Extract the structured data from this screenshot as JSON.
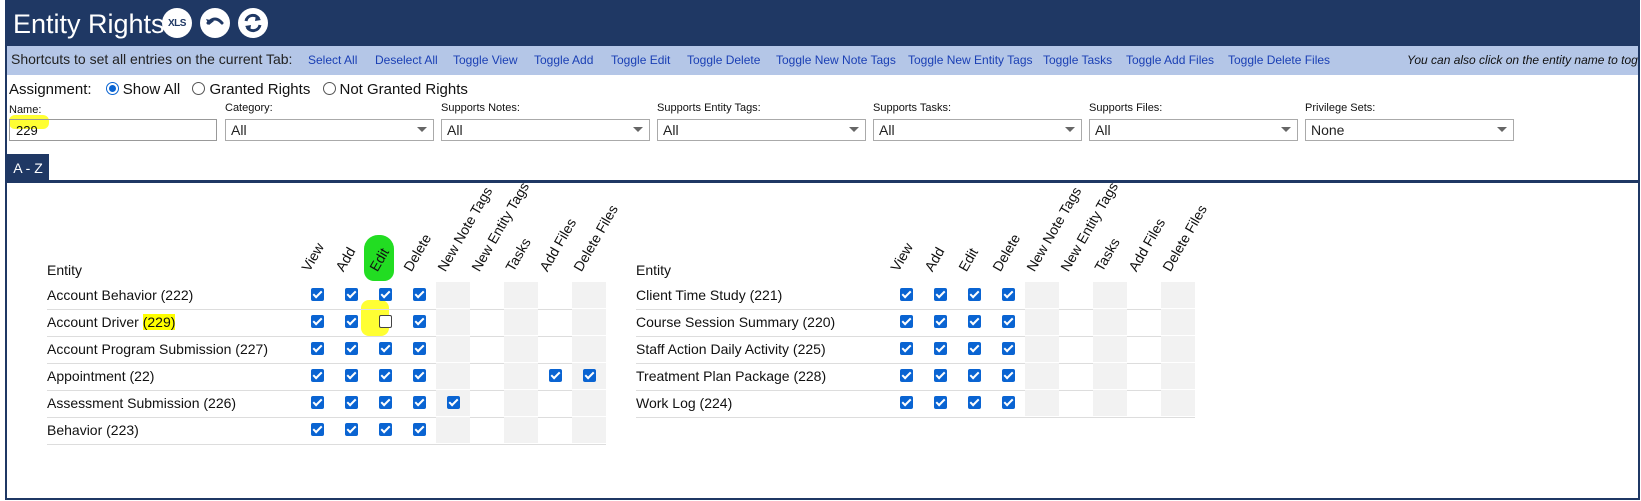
{
  "header": {
    "title": "Entity Rights",
    "icons": [
      "xls-export-icon",
      "undo-icon",
      "refresh-icon"
    ],
    "xls_text": "XLS"
  },
  "shortcuts": {
    "label": "Shortcuts to set all entries on the current Tab:",
    "links": [
      "Select All",
      "Deselect All",
      "Toggle View",
      "Toggle Add",
      "Toggle Edit",
      "Toggle Delete",
      "Toggle New Note Tags",
      "Toggle New Entity Tags",
      "Toggle Tasks",
      "Toggle Add Files",
      "Toggle Delete Files"
    ],
    "hint": "You can also click on the entity name to toggle"
  },
  "assignment": {
    "label": "Assignment:",
    "options": [
      {
        "label": "Show All",
        "selected": true
      },
      {
        "label": "Granted Rights",
        "selected": false
      },
      {
        "label": "Not Granted Rights",
        "selected": false
      }
    ]
  },
  "filters": {
    "name": {
      "label": "Name:",
      "value": "229"
    },
    "category": {
      "label": "Category:",
      "value": "All"
    },
    "supports_notes": {
      "label": "Supports Notes:",
      "value": "All"
    },
    "supports_entity_tags": {
      "label": "Supports Entity Tags:",
      "value": "All"
    },
    "supports_tasks": {
      "label": "Supports Tasks:",
      "value": "All"
    },
    "supports_files": {
      "label": "Supports Files:",
      "value": "All"
    },
    "privilege_sets": {
      "label": "Privilege Sets:",
      "value": "None"
    }
  },
  "tab": {
    "label": "A - Z"
  },
  "grid": {
    "entity_header": "Entity",
    "columns": [
      "View",
      "Add",
      "Edit",
      "Delete",
      "New Note Tags",
      "New Entity Tags",
      "Tasks",
      "Add Files",
      "Delete Files"
    ],
    "left": [
      {
        "name": "Account Behavior (222)",
        "rights": [
          1,
          1,
          1,
          1,
          0,
          0,
          0,
          0,
          0
        ]
      },
      {
        "name": "Account Driver ",
        "highlight": "(229)",
        "rights": [
          1,
          1,
          -1,
          1,
          0,
          0,
          0,
          0,
          0
        ]
      },
      {
        "name": "Account Program Submission (227)",
        "rights": [
          1,
          1,
          1,
          1,
          0,
          0,
          0,
          0,
          0
        ]
      },
      {
        "name": "Appointment (22)",
        "rights": [
          1,
          1,
          1,
          1,
          0,
          0,
          0,
          1,
          1
        ]
      },
      {
        "name": "Assessment Submission (226)",
        "rights": [
          1,
          1,
          1,
          1,
          1,
          0,
          0,
          0,
          0
        ]
      },
      {
        "name": "Behavior (223)",
        "rights": [
          1,
          1,
          1,
          1,
          0,
          0,
          0,
          0,
          0
        ]
      }
    ],
    "right": [
      {
        "name": "Client Time Study (221)",
        "rights": [
          1,
          1,
          1,
          1,
          0,
          0,
          0,
          0,
          0
        ]
      },
      {
        "name": "Course Session Summary (220)",
        "rights": [
          1,
          1,
          1,
          1,
          0,
          0,
          0,
          0,
          0
        ]
      },
      {
        "name": "Staff Action Daily Activity (225)",
        "rights": [
          1,
          1,
          1,
          1,
          0,
          0,
          0,
          0,
          0
        ]
      },
      {
        "name": "Treatment Plan Package (228)",
        "rights": [
          1,
          1,
          1,
          1,
          0,
          0,
          0,
          0,
          0
        ]
      },
      {
        "name": "Work Log (224)",
        "rights": [
          1,
          1,
          1,
          1,
          0,
          0,
          0,
          0,
          0
        ]
      }
    ]
  },
  "colors": {
    "header": "#1f3864",
    "shortcut_bar": "#b4c6e7",
    "link": "#1a3fb4",
    "checkbox": "#0a64d2",
    "highlight_yellow": "#ffff00",
    "highlight_green": "#22dd22"
  }
}
